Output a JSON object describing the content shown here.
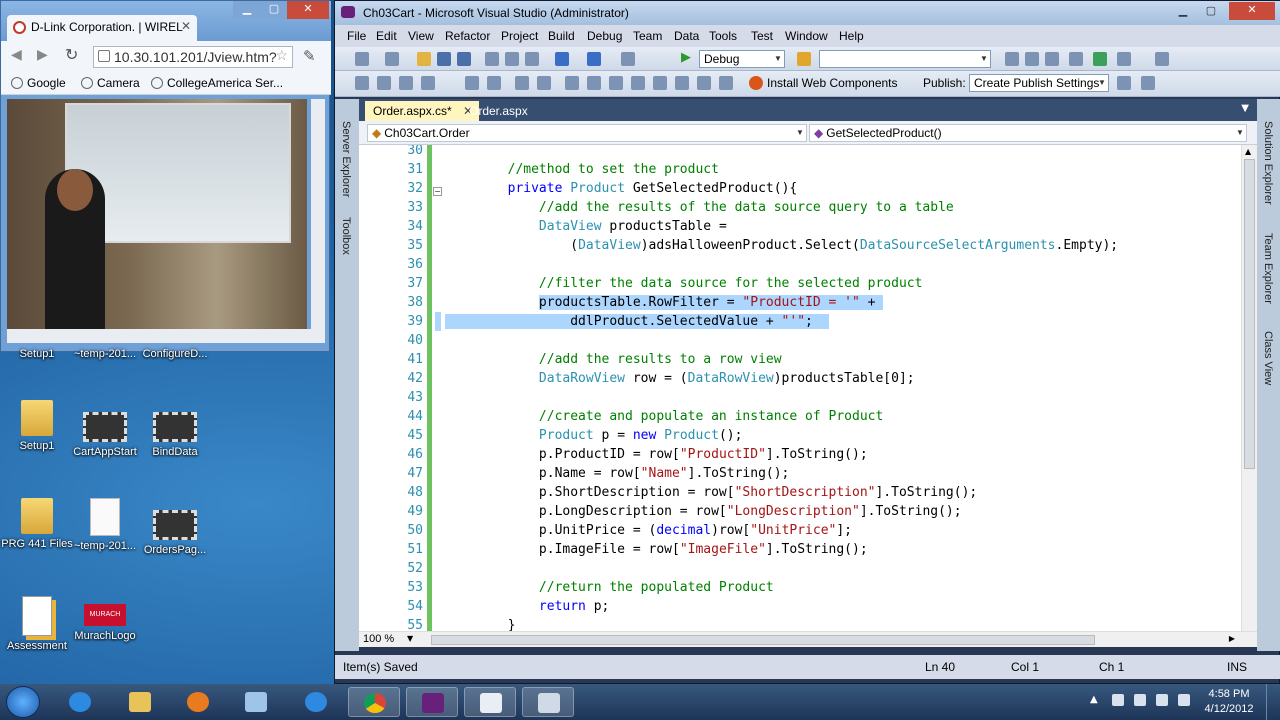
{
  "browser": {
    "tab_title": "D-Link Corporation. | WIREL",
    "url": "10.30.101.201/Jview.htm?",
    "bookmarks": [
      "Google",
      "Camera",
      "CollegeAmerica Ser..."
    ]
  },
  "desktop_icons": [
    {
      "label": "Setup1",
      "kind": "folder"
    },
    {
      "label": "~temp-201...",
      "kind": "film"
    },
    {
      "label": "ConfigureD...",
      "kind": "film"
    },
    {
      "label": "Setup1",
      "kind": "folder"
    },
    {
      "label": "CartAppStart",
      "kind": "film"
    },
    {
      "label": "BindData",
      "kind": "film"
    },
    {
      "label": "PRG 441 Files",
      "kind": "folder"
    },
    {
      "label": "~temp-201...",
      "kind": "file"
    },
    {
      "label": "OrdersPag...",
      "kind": "film"
    },
    {
      "label": "Assessment",
      "kind": "doc"
    },
    {
      "label": "MurachLogo",
      "kind": "murach"
    }
  ],
  "vs": {
    "title": "Ch03Cart - Microsoft Visual Studio (Administrator)",
    "menu": [
      "File",
      "Edit",
      "View",
      "Refactor",
      "Project",
      "Build",
      "Debug",
      "Team",
      "Data",
      "Tools",
      "Test",
      "Window",
      "Help"
    ],
    "config_combo": "Debug",
    "install_label": "Install Web Components",
    "publish_label": "Publish:",
    "publish_combo": "Create Publish Settings",
    "left_panels": [
      "Server Explorer",
      "Toolbox"
    ],
    "right_panels": [
      "Solution Explorer",
      "Team Explorer",
      "Class View"
    ],
    "tabs": [
      {
        "label": "Order.aspx.cs*",
        "active": true
      },
      {
        "label": "Order.aspx",
        "active": false
      }
    ],
    "nav_left": "Ch03Cart.Order",
    "nav_right": "GetSelectedProduct()",
    "zoom": "100 %",
    "status": {
      "message": "Item(s) Saved",
      "ln": "Ln 40",
      "col": "Col 1",
      "ch": "Ch 1",
      "mode": "INS"
    }
  },
  "code_lines": [
    {
      "n": "30",
      "t": [
        {
          "c": "",
          "s": ""
        }
      ]
    },
    {
      "n": "31",
      "t": [
        {
          "c": "cmt",
          "s": "        //method to set the product"
        }
      ]
    },
    {
      "n": "32",
      "t": [
        {
          "c": "kw",
          "s": "        private "
        },
        {
          "c": "typ",
          "s": "Product"
        },
        {
          "c": "",
          "s": " GetSelectedProduct(){"
        }
      ]
    },
    {
      "n": "33",
      "t": [
        {
          "c": "cmt",
          "s": "            //add the results of the data source query to a table"
        }
      ]
    },
    {
      "n": "34",
      "t": [
        {
          "c": "typ",
          "s": "            DataView"
        },
        {
          "c": "",
          "s": " productsTable ="
        }
      ]
    },
    {
      "n": "35",
      "t": [
        {
          "c": "",
          "s": "                ("
        },
        {
          "c": "typ",
          "s": "DataView"
        },
        {
          "c": "",
          "s": ")adsHalloweenProduct.Select("
        },
        {
          "c": "typ",
          "s": "DataSourceSelectArguments"
        },
        {
          "c": "",
          "s": ".Empty);"
        }
      ]
    },
    {
      "n": "36",
      "t": [
        {
          "c": "",
          "s": ""
        }
      ]
    },
    {
      "n": "37",
      "t": [
        {
          "c": "cmt",
          "s": "            //filter the data source for the selected product"
        }
      ]
    },
    {
      "n": "38",
      "sel": "a",
      "t": [
        {
          "c": "",
          "s": "            "
        },
        {
          "c": "sel",
          "s": "productsTable.RowFilter = "
        },
        {
          "c": "str sel",
          "s": "\"ProductID = '\""
        },
        {
          "c": "sel",
          "s": " + "
        }
      ]
    },
    {
      "n": "39",
      "sel": "b",
      "t": [
        {
          "c": "sel",
          "s": "                ddlProduct.SelectedValue + "
        },
        {
          "c": "str sel",
          "s": "\"'\""
        },
        {
          "c": "sel",
          "s": ";  "
        }
      ]
    },
    {
      "n": "40",
      "t": [
        {
          "c": "",
          "s": ""
        }
      ]
    },
    {
      "n": "41",
      "t": [
        {
          "c": "cmt",
          "s": "            //add the results to a row view"
        }
      ]
    },
    {
      "n": "42",
      "t": [
        {
          "c": "typ",
          "s": "            DataRowView"
        },
        {
          "c": "",
          "s": " row = ("
        },
        {
          "c": "typ",
          "s": "DataRowView"
        },
        {
          "c": "",
          "s": ")productsTable[0];"
        }
      ]
    },
    {
      "n": "43",
      "t": [
        {
          "c": "",
          "s": ""
        }
      ]
    },
    {
      "n": "44",
      "t": [
        {
          "c": "cmt",
          "s": "            //create and populate an instance of Product"
        }
      ]
    },
    {
      "n": "45",
      "t": [
        {
          "c": "typ",
          "s": "            Product"
        },
        {
          "c": "",
          "s": " p = "
        },
        {
          "c": "kw",
          "s": "new "
        },
        {
          "c": "typ",
          "s": "Product"
        },
        {
          "c": "",
          "s": "();"
        }
      ]
    },
    {
      "n": "46",
      "t": [
        {
          "c": "",
          "s": "            p.ProductID = row["
        },
        {
          "c": "str",
          "s": "\"ProductID\""
        },
        {
          "c": "",
          "s": "].ToString();"
        }
      ]
    },
    {
      "n": "47",
      "t": [
        {
          "c": "",
          "s": "            p.Name = row["
        },
        {
          "c": "str",
          "s": "\"Name\""
        },
        {
          "c": "",
          "s": "].ToString();"
        }
      ]
    },
    {
      "n": "48",
      "t": [
        {
          "c": "",
          "s": "            p.ShortDescription = row["
        },
        {
          "c": "str",
          "s": "\"ShortDescription\""
        },
        {
          "c": "",
          "s": "].ToString();"
        }
      ]
    },
    {
      "n": "49",
      "t": [
        {
          "c": "",
          "s": "            p.LongDescription = row["
        },
        {
          "c": "str",
          "s": "\"LongDescription\""
        },
        {
          "c": "",
          "s": "].ToString();"
        }
      ]
    },
    {
      "n": "50",
      "t": [
        {
          "c": "",
          "s": "            p.UnitPrice = ("
        },
        {
          "c": "kw",
          "s": "decimal"
        },
        {
          "c": "",
          "s": ")row["
        },
        {
          "c": "str",
          "s": "\"UnitPrice\""
        },
        {
          "c": "",
          "s": "];"
        }
      ]
    },
    {
      "n": "51",
      "t": [
        {
          "c": "",
          "s": "            p.ImageFile = row["
        },
        {
          "c": "str",
          "s": "\"ImageFile\""
        },
        {
          "c": "",
          "s": "].ToString();"
        }
      ]
    },
    {
      "n": "52",
      "t": [
        {
          "c": "",
          "s": ""
        }
      ]
    },
    {
      "n": "53",
      "t": [
        {
          "c": "cmt",
          "s": "            //return the populated Product"
        }
      ]
    },
    {
      "n": "54",
      "t": [
        {
          "c": "kw",
          "s": "            return"
        },
        {
          "c": "",
          "s": " p;"
        }
      ]
    },
    {
      "n": "55",
      "t": [
        {
          "c": "",
          "s": "        }"
        }
      ]
    }
  ],
  "taskbar": {
    "apps": [
      "ie-icon",
      "explorer-icon",
      "media-player-icon",
      "box-icon",
      "ie-icon",
      "chrome-icon",
      "vs-icon",
      "notepad-icon",
      "window-icon"
    ],
    "time": "4:58 PM",
    "date": "4/12/2012"
  }
}
